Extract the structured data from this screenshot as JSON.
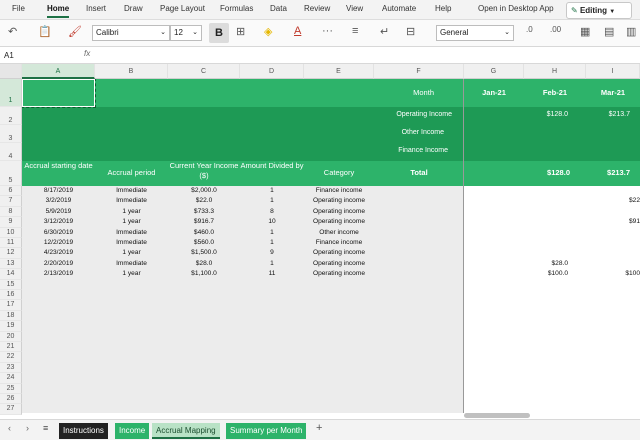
{
  "menu": {
    "file": "File",
    "home": "Home",
    "insert": "Insert",
    "draw": "Draw",
    "page_layout": "Page Layout",
    "formulas": "Formulas",
    "data": "Data",
    "review": "Review",
    "view": "View",
    "automate": "Automate",
    "help": "Help",
    "open_desktop": "Open in Desktop App",
    "editing": "Editing"
  },
  "ribbon": {
    "font_name": "Calibri",
    "font_size": "12",
    "bold": "B",
    "number_format": "General"
  },
  "formula_bar": {
    "name_box": "A1",
    "fx": "fx",
    "value": ""
  },
  "columns": [
    "A",
    "B",
    "C",
    "D",
    "E",
    "F",
    "G",
    "H",
    "I"
  ],
  "rows": [
    "1",
    "2",
    "3",
    "4",
    "5",
    "6",
    "7",
    "8",
    "9",
    "10",
    "11",
    "12",
    "13",
    "14",
    "15",
    "16",
    "17",
    "18",
    "19",
    "20",
    "21",
    "22",
    "23",
    "24",
    "25",
    "26",
    "27"
  ],
  "header": {
    "month_label": "Month",
    "months": [
      "Jan-21",
      "Feb-21",
      "Mar-21"
    ],
    "operating_income": "Operating Income",
    "other_income": "Other Income",
    "finance_income": "Finance Income",
    "total": "Total",
    "row2_values": [
      "",
      "$128.0",
      "$213.7"
    ],
    "total_values": [
      "",
      "$128.0",
      "$213.7"
    ],
    "col_headers": [
      "Accrual starting date",
      "Accrual period",
      "Current Year Income ($)",
      "Amount Divided by",
      "Category"
    ]
  },
  "table": [
    {
      "date": "8/17/2019",
      "period": "Immediate",
      "income": "$2,000.0",
      "divided": "1",
      "category": "Finance income",
      "h": "",
      "i": ""
    },
    {
      "date": "3/2/2019",
      "period": "Immediate",
      "income": "$22.0",
      "divided": "1",
      "category": "Operating income",
      "h": "",
      "i": "$22"
    },
    {
      "date": "5/9/2019",
      "period": "1 year",
      "income": "$733.3",
      "divided": "8",
      "category": "Operating income",
      "h": "",
      "i": ""
    },
    {
      "date": "3/12/2019",
      "period": "1 year",
      "income": "$916.7",
      "divided": "10",
      "category": "Operating income",
      "h": "",
      "i": "$91"
    },
    {
      "date": "6/30/2019",
      "period": "Immediate",
      "income": "$460.0",
      "divided": "1",
      "category": "Other income",
      "h": "",
      "i": ""
    },
    {
      "date": "12/2/2019",
      "period": "Immediate",
      "income": "$560.0",
      "divided": "1",
      "category": "Finance income",
      "h": "",
      "i": ""
    },
    {
      "date": "4/23/2019",
      "period": "1 year",
      "income": "$1,500.0",
      "divided": "9",
      "category": "Operating income",
      "h": "",
      "i": ""
    },
    {
      "date": "2/20/2019",
      "period": "Immediate",
      "income": "$28.0",
      "divided": "1",
      "category": "Operating income",
      "h": "$28.0",
      "i": ""
    },
    {
      "date": "2/13/2019",
      "period": "1 year",
      "income": "$1,100.0",
      "divided": "11",
      "category": "Operating income",
      "h": "$100.0",
      "i": "$100"
    }
  ],
  "tabs": [
    "Instructions",
    "Income",
    "Accrual Mapping",
    "Summary per Month"
  ],
  "colors": {
    "green_light": "#2db36a",
    "green_dark": "#1e9a55",
    "green_band": "#21a55b",
    "accent": "#1e7145",
    "gray_fill": "#ececec"
  }
}
